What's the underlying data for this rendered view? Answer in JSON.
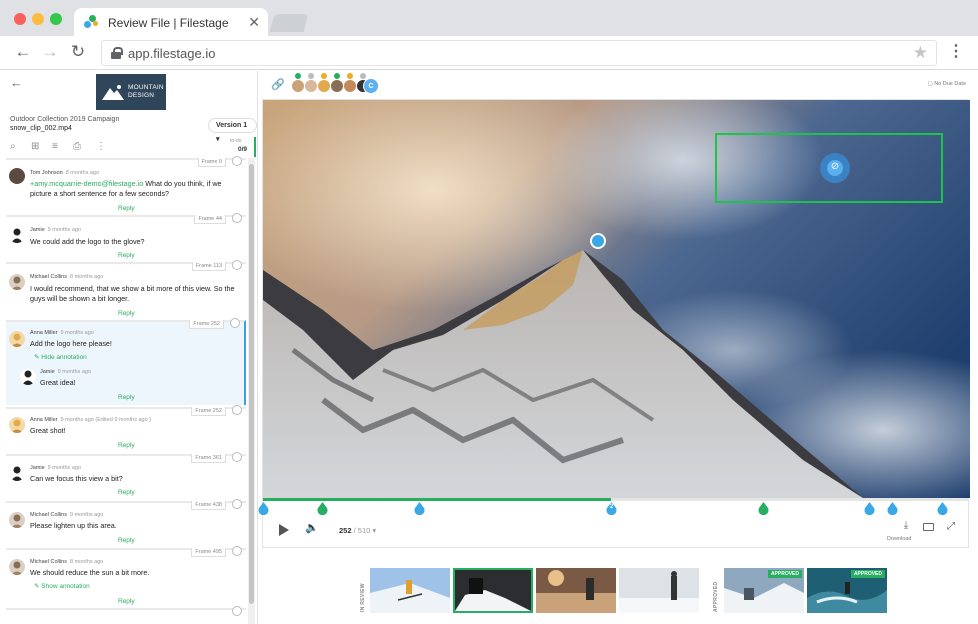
{
  "browser": {
    "tab_title": "Review File | Filestage",
    "tab_close": "✕",
    "url": "app.filestage.io"
  },
  "header": {
    "logo_line1": "MOUNTAIN",
    "logo_line2": "DESIGN",
    "campaign": "Outdoor Collection 2019 Campaign",
    "filename": "snow_clip_002.mp4",
    "version": "Version 1 ▾",
    "count_label": "to-do",
    "count": "0/9"
  },
  "comments": [
    {
      "author": "Tom Johnson",
      "time": "8 months ago",
      "frame": "Frame 0",
      "mention": "+amy.mcquarrie-demo@filestage.io",
      "text": " What do you think, if we picture a short sentence for a few seconds?",
      "reply": "Reply"
    },
    {
      "author": "Jamie",
      "time": "9 months ago",
      "frame": "Frame 44",
      "text": "We could add the logo to the glove?",
      "reply": "Reply"
    },
    {
      "author": "Michael Collins",
      "time": "8 months ago",
      "frame": "Frame 113",
      "text": "I would recommend, that we show a bit more of this view. So the guys will be shown a bit longer.",
      "reply": "Reply"
    },
    {
      "author": "Anna Miller",
      "time": "9 months ago",
      "frame": "Frame 252",
      "text": "Add the logo here please!",
      "annotation": "Hide annotation",
      "sub_author": "Jamie",
      "sub_time": "9 months ago",
      "sub_text": "Great idea!",
      "reply": "Reply"
    },
    {
      "author": "Anna Miller",
      "time": "9 months ago (Edited 9 months ago )",
      "frame": "Frame 252",
      "text": "Great shot!",
      "reply": "Reply"
    },
    {
      "author": "Jamie",
      "time": "9 months ago",
      "frame": "Frame 361",
      "text": "Can we focus this view a bit?",
      "reply": "Reply"
    },
    {
      "author": "Michael Collins",
      "time": "9 months ago",
      "frame": "Frame 438",
      "text": "Please lighten up this area.",
      "reply": "Reply"
    },
    {
      "author": "Michael Collins",
      "time": "8 months ago",
      "frame": "Frame 495",
      "text": "We should reduce the sun a bit more.",
      "annotation": "Show annotation",
      "reply": "Reply"
    }
  ],
  "right_header": {
    "due": "No Due Date",
    "initial": "C"
  },
  "player": {
    "current_frame": "252",
    "total_frames": " / 510 ▾",
    "marker_label": "2",
    "progress": 0.494,
    "download": "Download"
  },
  "thumbnails": {
    "in_review_label": "IN REVIEW",
    "approved_label": "APPROVED",
    "badge": "APPROVED"
  },
  "colors": {
    "accent_green": "#27ae60",
    "accent_blue": "#3aa8e6",
    "annotation_green": "#1fc24b"
  }
}
